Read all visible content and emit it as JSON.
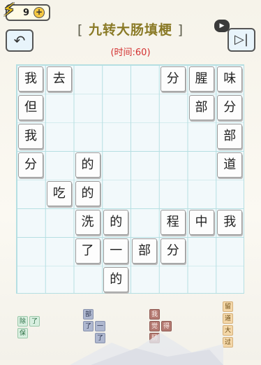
{
  "header": {
    "energy_count": "9",
    "energy_plus": "+",
    "title_open": "[",
    "title": "九转大肠填梗",
    "title_close": "]",
    "timer": "(时间:60)"
  },
  "board": {
    "tiles": [
      {
        "char": "我",
        "row": 0,
        "col": 0
      },
      {
        "char": "去",
        "row": 0,
        "col": 1
      },
      {
        "char": "分",
        "row": 0,
        "col": 5
      },
      {
        "char": "腥",
        "row": 0,
        "col": 6
      },
      {
        "char": "味",
        "row": 0,
        "col": 7
      },
      {
        "char": "但",
        "row": 1,
        "col": 0
      },
      {
        "char": "部",
        "row": 1,
        "col": 6
      },
      {
        "char": "分",
        "row": 1,
        "col": 7
      },
      {
        "char": "我",
        "row": 2,
        "col": 0
      },
      {
        "char": "部",
        "row": 2,
        "col": 7
      },
      {
        "char": "分",
        "row": 3,
        "col": 0
      },
      {
        "char": "的",
        "row": 3,
        "col": 2
      },
      {
        "char": "道",
        "row": 3,
        "col": 7
      },
      {
        "char": "吃",
        "row": 4,
        "col": 1
      },
      {
        "char": "的",
        "row": 4,
        "col": 2
      },
      {
        "char": "洗",
        "row": 5,
        "col": 2
      },
      {
        "char": "的",
        "row": 5,
        "col": 3
      },
      {
        "char": "程",
        "row": 5,
        "col": 5
      },
      {
        "char": "中",
        "row": 5,
        "col": 6
      },
      {
        "char": "我",
        "row": 5,
        "col": 7
      },
      {
        "char": "了",
        "row": 6,
        "col": 2
      },
      {
        "char": "一",
        "row": 6,
        "col": 3
      },
      {
        "char": "部",
        "row": 6,
        "col": 4
      },
      {
        "char": "分",
        "row": 6,
        "col": 5
      },
      {
        "char": "的",
        "row": 7,
        "col": 3
      }
    ]
  },
  "pieces": [
    {
      "color": "green",
      "cells": [
        {
          "char": "除",
          "r": 0,
          "c": 0
        },
        {
          "char": "了",
          "r": 0,
          "c": 1
        },
        {
          "char": "保",
          "r": 1,
          "c": 0
        }
      ]
    },
    {
      "color": "blue",
      "cells": [
        {
          "char": "部",
          "r": 0,
          "c": 0
        },
        {
          "char": "了",
          "r": 1,
          "c": 0
        },
        {
          "char": "一",
          "r": 1,
          "c": 1
        },
        {
          "char": "了",
          "r": 2,
          "c": 1
        }
      ]
    },
    {
      "color": "red",
      "cells": [
        {
          "char": "我",
          "r": 0,
          "c": 0
        },
        {
          "char": "觉",
          "r": 1,
          "c": 0
        },
        {
          "char": "得",
          "r": 1,
          "c": 1
        },
        {
          "char": "肠",
          "r": 2,
          "c": 0
        }
      ]
    },
    {
      "color": "yellow",
      "cells": [
        {
          "char": "留",
          "r": 0,
          "c": 0
        },
        {
          "char": "道",
          "r": 1,
          "c": 0
        },
        {
          "char": "大",
          "r": 2,
          "c": 0
        },
        {
          "char": "过",
          "r": 3,
          "c": 0
        }
      ]
    }
  ],
  "icons": {
    "energy": "lightning-bolt-icon",
    "back": "undo-arrow-icon",
    "video": "video-ad-icon",
    "skip": "skip-next-icon"
  },
  "colors": {
    "title": "#8a7a26",
    "timer": "#d32f2f",
    "grid_line": "#b5dfe2",
    "green_piece": "#d8efe0",
    "blue_piece": "#aeb7cf",
    "red_piece": "#b47a72",
    "yellow_piece": "#f4d7a8"
  }
}
